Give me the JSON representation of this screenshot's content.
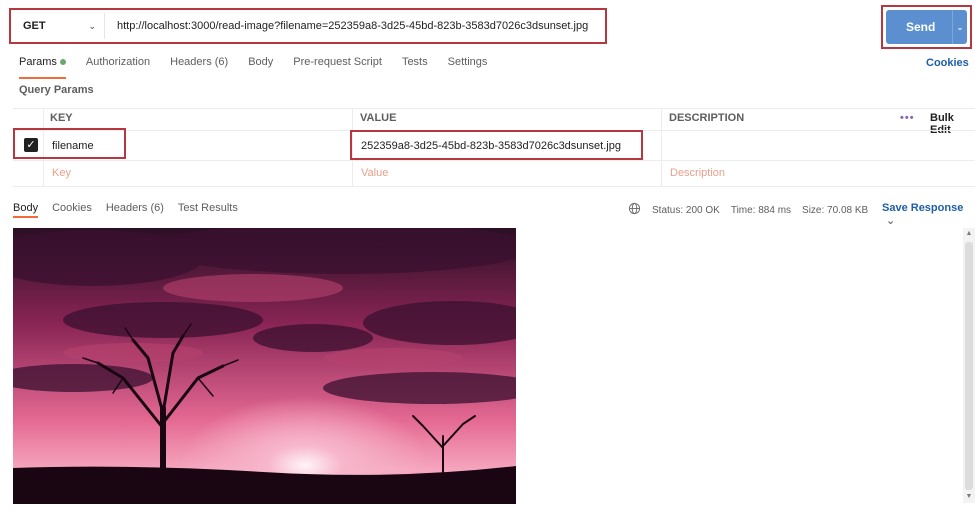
{
  "request": {
    "method": "GET",
    "url": "http://localhost:3000/read-image?filename=252359a8-3d25-45bd-823b-3583d7026c3dsunset.jpg",
    "send_label": "Send"
  },
  "tabs": [
    {
      "label": "Params"
    },
    {
      "label": "Authorization"
    },
    {
      "label": "Headers (6)"
    },
    {
      "label": "Body"
    },
    {
      "label": "Pre-request Script"
    },
    {
      "label": "Tests"
    },
    {
      "label": "Settings"
    }
  ],
  "cookies_label": "Cookies",
  "query_params": {
    "title": "Query Params",
    "headers": {
      "key": "KEY",
      "value": "VALUE",
      "description": "DESCRIPTION"
    },
    "bulk_edit": "Bulk Edit",
    "more": "•••",
    "row": {
      "checked": true,
      "key": "filename",
      "value": "252359a8-3d25-45bd-823b-3583d7026c3dsunset.jpg"
    },
    "placeholders": {
      "key": "Key",
      "value": "Value",
      "description": "Description"
    }
  },
  "response": {
    "tabs": [
      {
        "label": "Body"
      },
      {
        "label": "Cookies"
      },
      {
        "label": "Headers (6)"
      },
      {
        "label": "Test Results"
      }
    ],
    "status": "Status: 200 OK",
    "time": "Time: 884 ms",
    "size": "Size: 70.08 KB",
    "save_label": "Save Response"
  },
  "icons": {
    "globe": "globe-icon",
    "chevron": "chevron-down-icon",
    "check": "checkbox-checked-icon"
  },
  "colors": {
    "accent": "#f26b3a",
    "send": "#5b8fd0",
    "link": "#1f5ea8",
    "highlight": "#b5373f"
  }
}
